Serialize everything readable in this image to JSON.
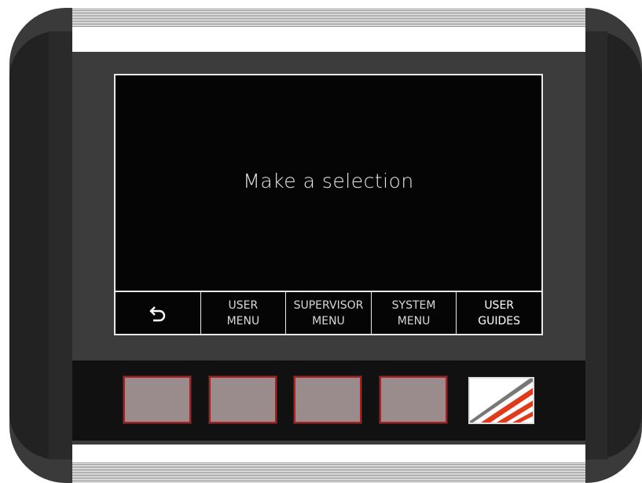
{
  "screen": {
    "message": "Make a selection"
  },
  "softkeys": [
    {
      "icon": "back-arrow-icon",
      "lines": [
        "",
        ""
      ]
    },
    {
      "lines": [
        "USER",
        "MENU"
      ]
    },
    {
      "lines": [
        "SUPERVISOR",
        "MENU"
      ]
    },
    {
      "lines": [
        "SYSTEM",
        "MENU"
      ]
    },
    {
      "lines": [
        "USER",
        "GUIDES"
      ]
    }
  ],
  "colors": {
    "key_fill": "#9a8c8c",
    "key_border": "#b71a1a",
    "logo_accent": "#e03a1a"
  },
  "hardware_keys": [
    "key-1",
    "key-2",
    "key-3",
    "key-4",
    "logo-key"
  ]
}
